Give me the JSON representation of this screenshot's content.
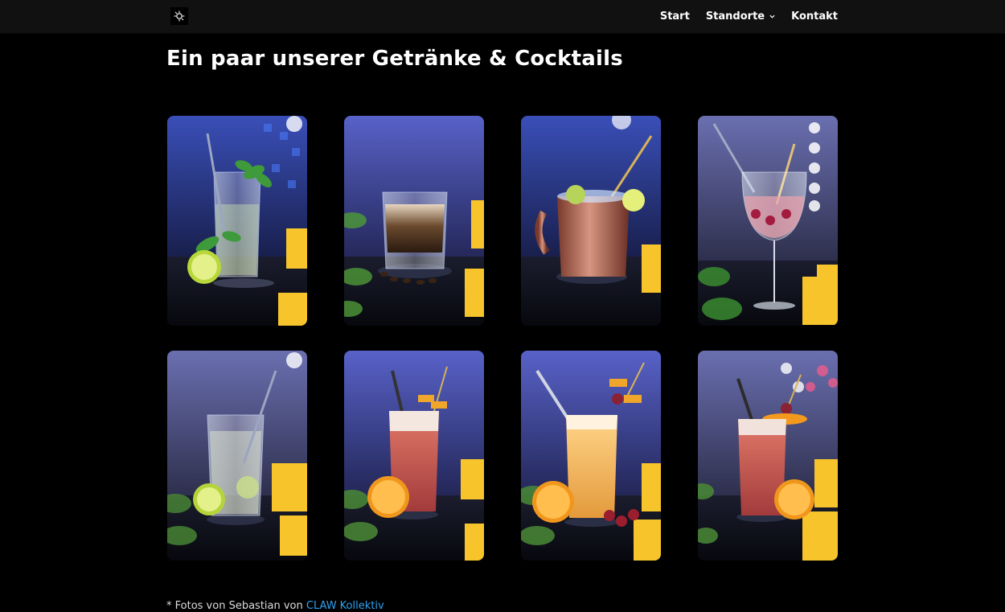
{
  "header": {
    "nav": [
      {
        "label": "Start"
      },
      {
        "label": "Standorte"
      },
      {
        "label": "Kontakt"
      }
    ]
  },
  "main": {
    "title": "Ein paar unserer Getränke & Cocktails",
    "credit_prefix": "* Fotos von Sebastian von ",
    "credit_link": "CLAW Kollektiv"
  },
  "colors": {
    "background": "#000000",
    "header_bg": "#111111",
    "link": "#2ea3f2"
  }
}
